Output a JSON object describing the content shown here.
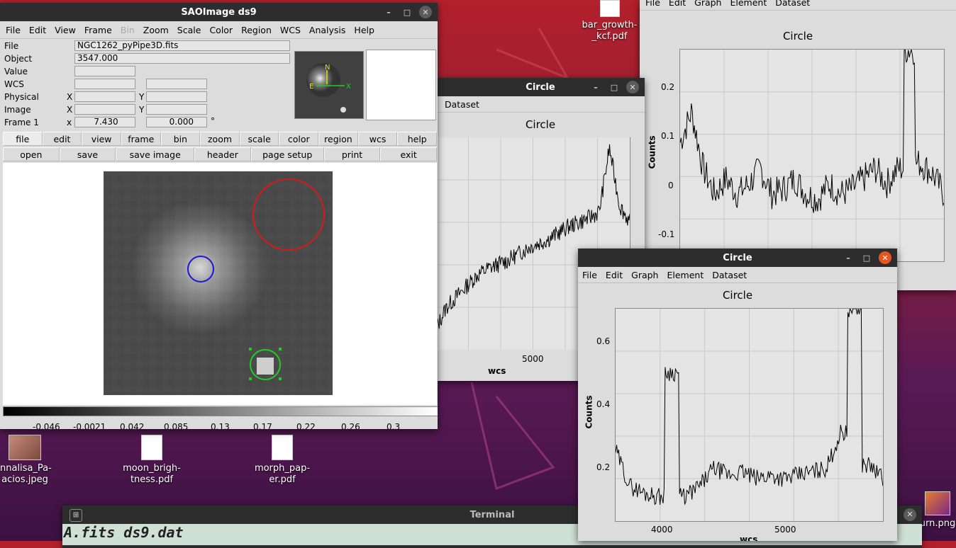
{
  "desktop": {
    "icons": [
      {
        "label": "bar_growth-\n_kcf.pdf"
      },
      {
        "label": "nnalisa_Pa-\nacios.jpeg"
      },
      {
        "label": "moon_brigh-\ntness.pdf"
      },
      {
        "label": "morph_pap-\ner.pdf"
      },
      {
        "label": "urn.png"
      }
    ]
  },
  "ds9": {
    "title": "SAOImage ds9",
    "menu": [
      "File",
      "Edit",
      "View",
      "Frame",
      "Bin",
      "Zoom",
      "Scale",
      "Color",
      "Region",
      "WCS",
      "Analysis",
      "Help"
    ],
    "info": {
      "file_label": "File",
      "file_value": "NGC1262_pyPipe3D.fits",
      "object_label": "Object",
      "object_value": "3547.000",
      "value_label": "Value",
      "wcs_label": "WCS",
      "physical_label": "Physical",
      "image_label": "Image",
      "frame_label": "Frame 1",
      "x": "X",
      "y": "Y",
      "x_lower": "x",
      "frame_x": "7.430",
      "frame_y": "0.000",
      "degree": "°"
    },
    "panner": {
      "n": "N",
      "e": "E",
      "x": "X"
    },
    "buttons_row1": [
      "file",
      "edit",
      "view",
      "frame",
      "bin",
      "zoom",
      "scale",
      "color",
      "region",
      "wcs",
      "help"
    ],
    "buttons_row2": [
      "open",
      "save",
      "save image",
      "header",
      "page setup",
      "print",
      "exit"
    ],
    "colorbar_ticks": [
      "-0.046",
      "-0.0021",
      "0.042",
      "0.085",
      "0.13",
      "0.17",
      "0.22",
      "0.26",
      "0.3"
    ],
    "regions": {
      "red": "#d31b1b",
      "blue": "#1a1ad0",
      "green": "#22cc22"
    }
  },
  "plot_right_top": {
    "window_title": "Circle",
    "menu": [
      "File",
      "Edit",
      "Graph",
      "Element",
      "Dataset"
    ],
    "title": "Circle",
    "ylabel": "Counts",
    "yticks": [
      "0.2",
      "0.1",
      "0",
      "-0.1"
    ]
  },
  "plot_middle": {
    "window_title": "Circle",
    "menu": [
      "Dataset"
    ],
    "title": "Circle",
    "xlabel": "wcs",
    "xticks": [
      "5000"
    ]
  },
  "plot_front": {
    "window_title": "Circle",
    "menu": [
      "File",
      "Edit",
      "Graph",
      "Element",
      "Dataset"
    ],
    "title": "Circle",
    "ylabel": "Counts",
    "xlabel": "wcs",
    "yticks": [
      "0.6",
      "0.4",
      "0.2"
    ],
    "xticks": [
      "4000",
      "5000"
    ]
  },
  "terminal": {
    "title": "Terminal",
    "text": "A.fits  ds9.dat"
  },
  "chart_data": [
    {
      "type": "line",
      "title": "Circle",
      "ylabel": "Counts",
      "ylim": [
        -0.13,
        0.28
      ],
      "series": [
        {
          "values": [
            0.1,
            0.16,
            0.05,
            0.0,
            0.03,
            0.0,
            0.02,
            0.05,
            0.0,
            0.01,
            0.03,
            0.0,
            -0.01,
            0.02,
            0.0,
            0.01,
            0.03,
            0.05,
            0.02,
            0.05,
            0.28,
            0.06,
            0.04,
            0.0
          ]
        }
      ]
    },
    {
      "type": "line",
      "title": "Circle",
      "xlabel": "wcs",
      "series": [
        {
          "values": [
            0.1,
            0.2,
            0.25,
            0.3,
            0.35,
            0.38,
            0.4,
            0.42,
            0.45,
            0.48,
            0.5,
            0.52,
            0.55,
            0.58,
            0.6,
            0.62,
            0.65,
            0.95,
            0.68,
            0.6
          ]
        }
      ]
    },
    {
      "type": "line",
      "title": "Circle",
      "xlabel": "wcs",
      "ylabel": "Counts",
      "ylim": [
        0.1,
        0.7
      ],
      "xlim": [
        3600,
        5800
      ],
      "series": [
        {
          "values": [
            0.3,
            0.2,
            0.18,
            0.17,
            0.52,
            0.17,
            0.2,
            0.25,
            0.23,
            0.24,
            0.22,
            0.23,
            0.22,
            0.23,
            0.24,
            0.25,
            0.35,
            0.7,
            0.26,
            0.22
          ]
        }
      ]
    }
  ]
}
